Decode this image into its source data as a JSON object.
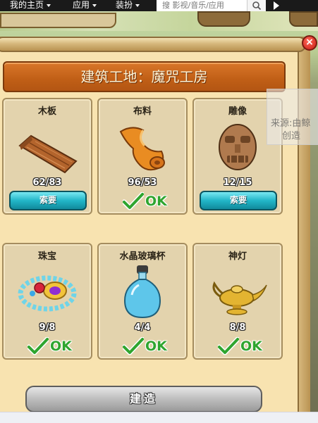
{
  "topnav": {
    "items": [
      {
        "label": "我的主页"
      },
      {
        "label": "应用"
      },
      {
        "label": "装扮"
      }
    ],
    "search_placeholder": "搜 影视/音乐/应用"
  },
  "dialog": {
    "title": "建筑工地：魔咒工房",
    "build_label": "建造",
    "close_label": "×"
  },
  "items": [
    {
      "name": "木板",
      "count": "62/83",
      "icon": "wood-plank-icon",
      "action": "索要"
    },
    {
      "name": "布料",
      "count": "96/53",
      "icon": "cloth-roll-icon",
      "status": "OK"
    },
    {
      "name": "雕像",
      "count": "12/15",
      "icon": "statue-icon",
      "action": "索要"
    },
    {
      "name": "珠宝",
      "count": "9/8",
      "icon": "jewelry-icon",
      "status": "OK"
    },
    {
      "name": "水晶玻璃杯",
      "count": "4/4",
      "icon": "crystal-bottle-icon",
      "status": "OK"
    },
    {
      "name": "神灯",
      "count": "8/8",
      "icon": "magic-lamp-icon",
      "status": "OK"
    }
  ],
  "watermark": {
    "line1": "来源:由鲸",
    "line2": "创造"
  },
  "colors": {
    "ok_green": "#2fa52f",
    "ask_button": "#22b6c8",
    "title_banner": "#c05f16",
    "panel": "#f8e3b0"
  }
}
